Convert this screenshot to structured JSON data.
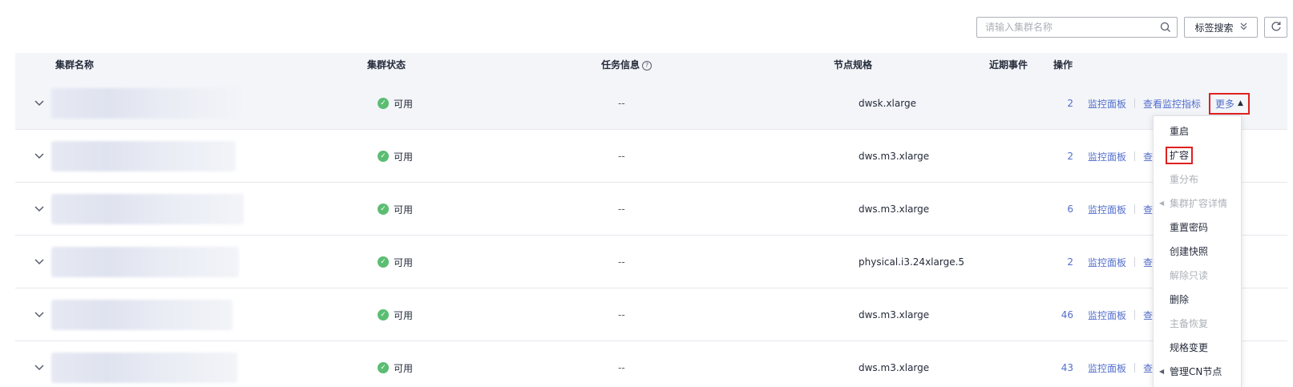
{
  "toolbar": {
    "search_placeholder": "请输入集群名称",
    "search_icon": "search-icon",
    "tag_search_label": "标签搜索",
    "tag_search_icon": "double-chevron-down-icon",
    "refresh_icon": "refresh-icon"
  },
  "table": {
    "headers": {
      "name": "集群名称",
      "status": "集群状态",
      "task": "任务信息",
      "spec": "节点规格",
      "events": "近期事件",
      "ops": "操作"
    },
    "rows": [
      {
        "status": "可用",
        "task": "--",
        "spec": "dwsk.xlarge",
        "events": "2",
        "op1": "监控面板",
        "op2": "查看监控指标",
        "op3": "更多"
      },
      {
        "status": "可用",
        "task": "--",
        "spec": "dws.m3.xlarge",
        "events": "2",
        "op1": "监控面板",
        "op2": "查看"
      },
      {
        "status": "可用",
        "task": "--",
        "spec": "dws.m3.xlarge",
        "events": "6",
        "op1": "监控面板",
        "op2": "查看"
      },
      {
        "status": "可用",
        "task": "--",
        "spec": "physical.i3.24xlarge.5",
        "events": "2",
        "op1": "监控面板",
        "op2": "查看"
      },
      {
        "status": "可用",
        "task": "--",
        "spec": "dws.m3.xlarge",
        "events": "46",
        "op1": "监控面板",
        "op2": "查看"
      },
      {
        "status": "可用",
        "task": "--",
        "spec": "dws.m3.xlarge",
        "events": "43",
        "op1": "监控面板",
        "op2": "查看"
      }
    ]
  },
  "dropdown": {
    "items": [
      {
        "label": "重启",
        "disabled": false,
        "submenu": false
      },
      {
        "label": "扩容",
        "disabled": false,
        "submenu": false,
        "highlighted": true
      },
      {
        "label": "重分布",
        "disabled": true,
        "submenu": false
      },
      {
        "label": "集群扩容详情",
        "disabled": true,
        "submenu": true
      },
      {
        "label": "重置密码",
        "disabled": false,
        "submenu": false
      },
      {
        "label": "创建快照",
        "disabled": false,
        "submenu": false
      },
      {
        "label": "解除只读",
        "disabled": true,
        "submenu": false
      },
      {
        "label": "删除",
        "disabled": false,
        "submenu": false
      },
      {
        "label": "主备恢复",
        "disabled": true,
        "submenu": false
      },
      {
        "label": "规格变更",
        "disabled": false,
        "submenu": false
      },
      {
        "label": "管理CN节点",
        "disabled": false,
        "submenu": true
      }
    ]
  },
  "colors": {
    "link": "#526ecc",
    "status_ok": "#5bbd72",
    "highlight_border": "#e02020",
    "header_bg": "#f3f5f9"
  }
}
